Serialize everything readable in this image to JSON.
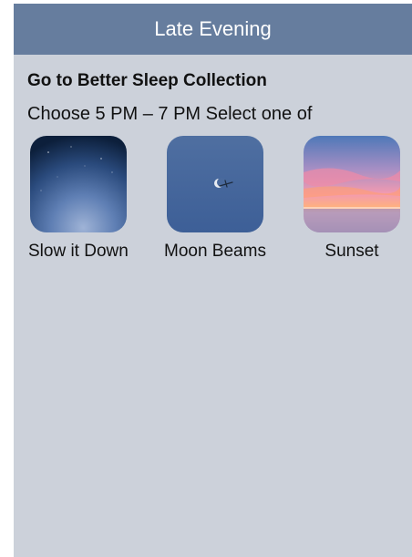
{
  "header": {
    "title": "Late Evening"
  },
  "collection": {
    "title": "Go to Better Sleep Collection",
    "instruction": "Choose 5 PM – 7 PM Select one of"
  },
  "sounds": [
    {
      "label": "Slow it Down",
      "icon": "night-sky-thumbnail"
    },
    {
      "label": "Moon Beams",
      "icon": "moon-thumbnail"
    },
    {
      "label": "Sunset",
      "icon": "sunset-thumbnail"
    }
  ],
  "colors": {
    "header_bg": "#667d9e",
    "screen_bg": "#ccd1da"
  }
}
